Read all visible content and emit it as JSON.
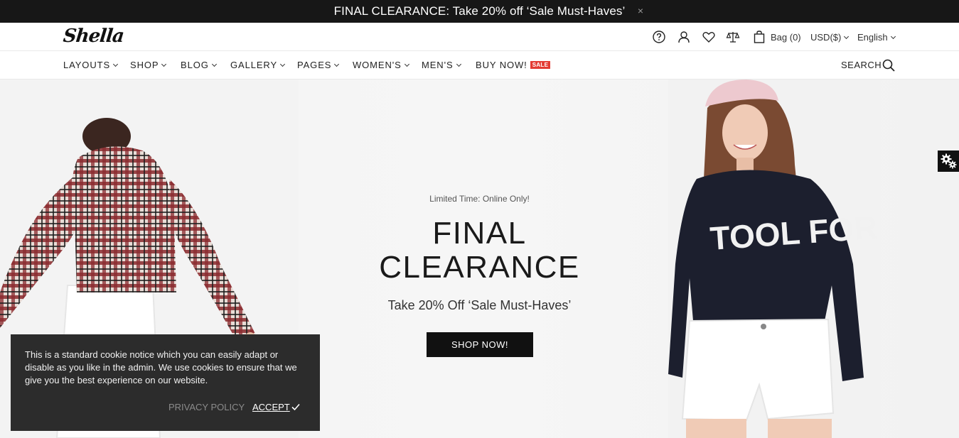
{
  "announcement": {
    "text": "FINAL CLEARANCE: Take 20% off ‘Sale Must-Haves’",
    "close_glyph": "×"
  },
  "header": {
    "logo": "Shella",
    "bag_label": "Bag (0)",
    "currency": "USD($)",
    "language": "English",
    "icons": [
      "help-icon",
      "account-icon",
      "wishlist-icon",
      "compare-icon",
      "bag-icon"
    ]
  },
  "nav": {
    "items": [
      {
        "label": "LAYOUTS"
      },
      {
        "label": "SHOP"
      },
      {
        "label": "BLOG"
      },
      {
        "label": "GALLERY"
      },
      {
        "label": "PAGES"
      },
      {
        "label": "WOMEN'S"
      },
      {
        "label": "MEN'S"
      },
      {
        "label": "BUY NOW!",
        "badge": "SALE"
      }
    ],
    "search_label": "SEARCH"
  },
  "hero": {
    "kicker": "Limited Time: Online Only!",
    "title_line1": "FINAL",
    "title_line2": "CLEARANCE",
    "subtitle": "Take 20% Off ‘Sale Must-Haves’",
    "button": "SHOP NOW!",
    "sweater_text": "TOOL FOR YOU"
  },
  "cookie": {
    "text": "This is a standard cookie notice which you can easily adapt or disable as you like in the admin. We use cookies to ensure that we give you the best experience on our website.",
    "privacy_label": "PRIVACY POLICY",
    "accept_label": "ACCEPT"
  },
  "colors": {
    "announcement_bg": "#171717",
    "sale_badge": "#e33b33",
    "button_bg": "#111111",
    "cookie_bg": "#2c2c2c"
  }
}
